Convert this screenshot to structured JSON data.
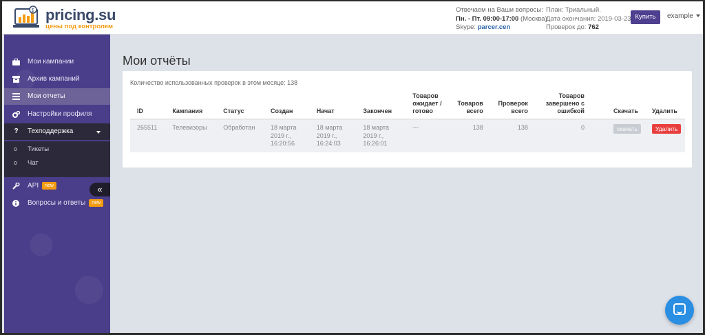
{
  "header": {
    "logo": {
      "name": "pricing.su",
      "tagline": "цены под контролем"
    },
    "contact": {
      "line1": "Отвечаем на Ваши вопросы:",
      "hours_bold": "Пн. - Пт. 09:00-17:00",
      "hours_tz": "(Москва)",
      "skype_label": "Skype:",
      "skype_value": "parcer.cen"
    },
    "plan": {
      "plan_label": "План: Триальный.",
      "end_label": "Дата окончания: 2019-03-23.",
      "checks_label": "Проверок до:",
      "checks_value": "762"
    },
    "buy_label": "Купить",
    "user_label": "example"
  },
  "sidebar": {
    "items": [
      {
        "label": "Мои кампании",
        "icon": "briefcase-icon"
      },
      {
        "label": "Архив кампаний",
        "icon": "archive-icon"
      },
      {
        "label": "Мои отчеты",
        "icon": "reports-icon"
      },
      {
        "label": "Настройки профиля",
        "icon": "gears-icon"
      },
      {
        "label": "Техподдержка",
        "icon": "question-icon"
      },
      {
        "label": "API",
        "icon": "wrench-icon",
        "badge": "new"
      },
      {
        "label": "Вопросы и ответы",
        "icon": "info-icon",
        "badge": "new"
      }
    ],
    "support_sub": [
      "Тикеты",
      "Чат"
    ],
    "collapse_label": "«"
  },
  "main": {
    "title": "Мои отчёты",
    "usage_note": "Количество использованных проверок в этом месяце: 138",
    "columns": {
      "id": "ID",
      "campaign": "Кампания",
      "status": "Статус",
      "created": "Создан",
      "started": "Начат",
      "finished": "Закончен",
      "waiting_1": "Товаров",
      "waiting_2": "ожидает /",
      "waiting_3": "готово",
      "total_1": "Товаров",
      "total_2": "всего",
      "checks_1": "Проверок",
      "checks_2": "всего",
      "errors_1": "Товаров",
      "errors_2": "завершено с",
      "errors_3": "ошибкой",
      "download": "Скачать",
      "delete": "Удалить"
    },
    "rows": [
      {
        "id": "265511",
        "campaign": "Телевизоры",
        "status": "Обработан",
        "created_1": "18 марта",
        "created_2": "2019 г.,",
        "created_3": "16:20:56",
        "started_1": "18 марта",
        "started_2": "2019 г.,",
        "started_3": "16:24:03",
        "finished_1": "18 марта",
        "finished_2": "2019 г.,",
        "finished_3": "16:26:01",
        "waiting": "---",
        "total": "138",
        "checks": "138",
        "errors": "0",
        "download_label": "скачать",
        "delete_label": "Удалить"
      }
    ]
  },
  "colors": {
    "sidebar": "#4a3d8a",
    "accent_buy": "#4e3f8f",
    "delete": "#e9403f",
    "badge_new": "#f39c12",
    "chat": "#2a8ee3"
  }
}
